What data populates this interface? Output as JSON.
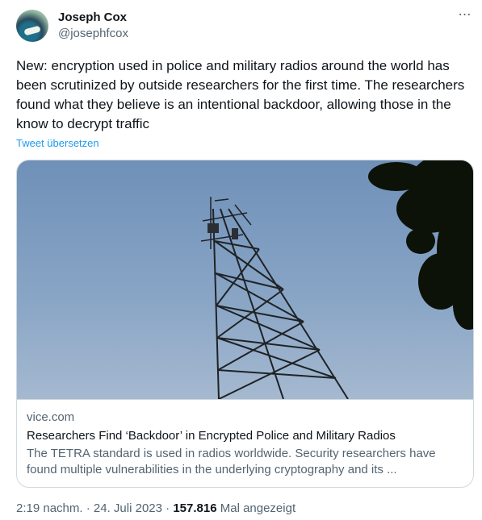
{
  "author": {
    "name": "Joseph Cox",
    "handle": "@josephfcox"
  },
  "more_icon": "more-horizontal-icon",
  "tweet": {
    "text": "New: encryption used in police and military radios around the world has been scrutinized by outside researchers for the first time. The researchers found what they believe is an intentional backdoor, allowing those in the know to decrypt traffic",
    "translate_label": "Tweet übersetzen"
  },
  "card": {
    "domain": "vice.com",
    "title": "Researchers Find ‘Backdoor’ in Encrypted Police and Military Radios",
    "description": "The TETRA standard is used in radios worldwide. Security researchers have found multiple vulnerabilities in the underlying cryptography and its ..."
  },
  "meta": {
    "time": "2:19 nachm.",
    "separator1": " · ",
    "date": "24. Juli 2023",
    "separator2": " · ",
    "views": "157.816",
    "views_label": " Mal angezeigt"
  },
  "colors": {
    "link": "#1d9bf0",
    "secondary_text": "#536471",
    "primary_text": "#0f1419",
    "border": "#cfd9de",
    "sky": "#7d9bbf"
  }
}
